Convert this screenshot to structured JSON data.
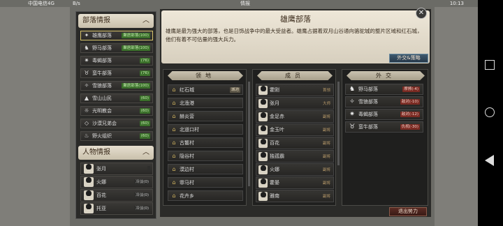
{
  "status_bar": {
    "carrier": "中国电信4G",
    "speed": "B/s",
    "title": "情报",
    "time": "10:13"
  },
  "tribe_section": {
    "title": "部落情报",
    "items": [
      {
        "name": "雄鹰部落",
        "badge": "聚居部落(100)",
        "icon": "eagle-icon",
        "selected": true
      },
      {
        "name": "野马部落",
        "badge": "聚居部落(100)",
        "icon": "horse-icon"
      },
      {
        "name": "毒蝎部落",
        "badge": "(76)",
        "icon": "scorpion-icon"
      },
      {
        "name": "蛮牛部落",
        "badge": "(76)",
        "icon": "bull-icon"
      },
      {
        "name": "雪狼部落",
        "badge": "聚居部落(100)",
        "icon": "wolf-icon"
      },
      {
        "name": "雪山山民",
        "badge": "(60)",
        "icon": "mountain-icon"
      },
      {
        "name": "光明教会",
        "badge": "(60)",
        "icon": "sun-icon"
      },
      {
        "name": "沙漠兄弟会",
        "badge": "(60)",
        "icon": "desert-icon"
      },
      {
        "name": "野火组织",
        "badge": "(60)",
        "icon": "fire-icon"
      }
    ]
  },
  "people_section": {
    "title": "人物情报",
    "items": [
      {
        "name": "张月",
        "status": ""
      },
      {
        "name": "火娜",
        "status": "冷淡(0)"
      },
      {
        "name": "百花",
        "status": "冷淡(0)"
      },
      {
        "name": "托亚",
        "status": "冷淡(0)"
      }
    ]
  },
  "detail": {
    "title": "雄鹰部落",
    "description": "雄鹰是最为强大的部落，也是日饰战争中的最大受益者。雄鹰占据着双月山谷通向骆驼城的整片区域和红石城，他们有着不可估量的强大兵力。",
    "diplomacy_button": "外交&策略",
    "exit_button": "退出势力",
    "close_icon": "close-icon"
  },
  "territory": {
    "header": "领地",
    "items": [
      {
        "name": "红石城",
        "tag": "城池"
      },
      {
        "name": "北渔港"
      },
      {
        "name": "赫炎营"
      },
      {
        "name": "北道口村"
      },
      {
        "name": "古鳌村"
      },
      {
        "name": "隐谷村"
      },
      {
        "name": "漠边村"
      },
      {
        "name": "霏马村"
      },
      {
        "name": "花卉乡"
      }
    ]
  },
  "members": {
    "header": "成员",
    "items": [
      {
        "name": "霍刚",
        "rank": "首领"
      },
      {
        "name": "张月",
        "rank": "大师"
      },
      {
        "name": "金足赤",
        "rank": "副将"
      },
      {
        "name": "金玉叶",
        "rank": "副将"
      },
      {
        "name": "百花",
        "rank": "副将"
      },
      {
        "name": "独孤霸",
        "rank": "副将"
      },
      {
        "name": "火娜",
        "rank": "副将"
      },
      {
        "name": "霍晏",
        "rank": "副将"
      },
      {
        "name": "雅南",
        "rank": "副将"
      }
    ]
  },
  "diplomacy": {
    "header": "外交",
    "items": [
      {
        "name": "野马部落",
        "relation": "摩擦(-4)",
        "icon": "horse-icon"
      },
      {
        "name": "雪狼部落",
        "relation": "敌对(-10)",
        "icon": "wolf-icon"
      },
      {
        "name": "毒蝎部落",
        "relation": "敌对(-12)",
        "icon": "scorpion-icon"
      },
      {
        "name": "蛮牛部落",
        "relation": "仇视(-30)",
        "icon": "bull-icon"
      }
    ]
  },
  "colors": {
    "accent": "#d7c36a",
    "parchment": "#e6dfcf",
    "hostile": "#7a2a22",
    "friendly": "#3a6f2a"
  }
}
